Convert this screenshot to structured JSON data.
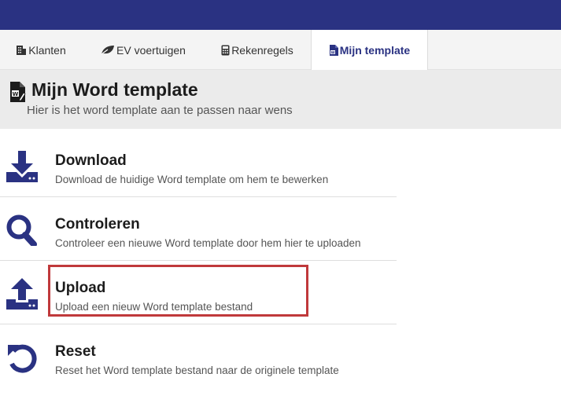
{
  "tabs": [
    {
      "label": "Klanten",
      "icon": "building-icon"
    },
    {
      "label": "EV voertuigen",
      "icon": "leaf-icon"
    },
    {
      "label": "Rekenregels",
      "icon": "calculator-icon"
    },
    {
      "label": "Mijn template",
      "icon": "word-file-icon",
      "active": true
    }
  ],
  "header": {
    "title": "Mijn Word template",
    "subtitle": "Hier is het word template aan te passen naar wens"
  },
  "actions": [
    {
      "title": "Download",
      "description": "Download de huidige Word template om hem te bewerken",
      "icon": "download-icon"
    },
    {
      "title": "Controleren",
      "description": "Controleer een nieuwe Word template door hem hier te uploaden",
      "icon": "search-icon"
    },
    {
      "title": "Upload",
      "description": "Upload een nieuw Word template bestand",
      "icon": "upload-icon",
      "highlighted": true
    },
    {
      "title": "Reset",
      "description": "Reset het Word template bestand naar de originele template",
      "icon": "undo-icon"
    }
  ],
  "colors": {
    "brand": "#2a3282",
    "highlight": "#c0393b"
  }
}
